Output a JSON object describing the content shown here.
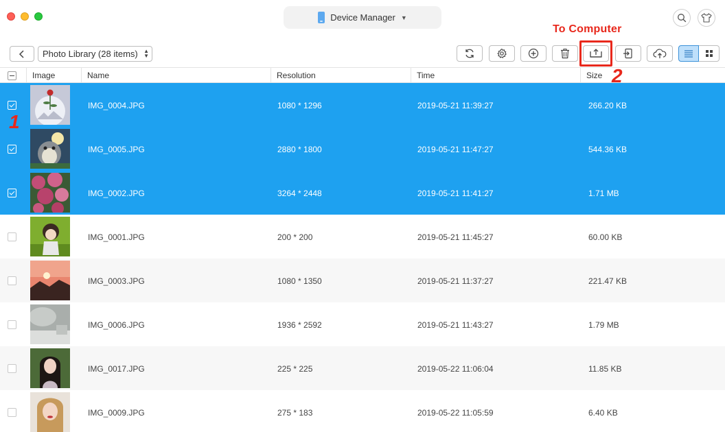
{
  "window": {
    "device_name": "Device Manager"
  },
  "annotations": {
    "to_computer_label": "To Computer",
    "step_2": "2",
    "step_1": "1"
  },
  "toolbar": {
    "library_label": "Photo Library (28 items)",
    "active_view": "list"
  },
  "table": {
    "headers": {
      "image": "Image",
      "name": "Name",
      "resolution": "Resolution",
      "time": "Time",
      "size": "Size"
    },
    "rows": [
      {
        "name": "IMG_0004.JPG",
        "resolution": "1080 * 1296",
        "time": "2019-05-21 11:39:27",
        "size": "266.20 KB",
        "selected": true,
        "thumb": "flower-on-sphere"
      },
      {
        "name": "IMG_0005.JPG",
        "resolution": "2880 * 1800",
        "time": "2019-05-21 11:47:27",
        "size": "544.36 KB",
        "selected": true,
        "thumb": "totoro"
      },
      {
        "name": "IMG_0002.JPG",
        "resolution": "3264 * 2448",
        "time": "2019-05-21 11:41:27",
        "size": "1.71 MB",
        "selected": true,
        "thumb": "pink-flowers"
      },
      {
        "name": "IMG_0001.JPG",
        "resolution": "200 * 200",
        "time": "2019-05-21 11:45:27",
        "size": "60.00 KB",
        "selected": false,
        "thumb": "doll-on-green"
      },
      {
        "name": "IMG_0003.JPG",
        "resolution": "1080 * 1350",
        "time": "2019-05-21 11:37:27",
        "size": "221.47 KB",
        "selected": false,
        "thumb": "sunset"
      },
      {
        "name": "IMG_0006.JPG",
        "resolution": "1936 * 2592",
        "time": "2019-05-21 11:43:27",
        "size": "1.79 MB",
        "selected": false,
        "thumb": "foggy-grey"
      },
      {
        "name": "IMG_0017.JPG",
        "resolution": "225 * 225",
        "time": "2019-05-22 11:06:04",
        "size": "11.85 KB",
        "selected": false,
        "thumb": "portrait-woman"
      },
      {
        "name": "IMG_0009.JPG",
        "resolution": "275 * 183",
        "time": "2019-05-22 11:05:59",
        "size": "6.40 KB",
        "selected": false,
        "thumb": "blonde-portrait"
      }
    ]
  },
  "colors": {
    "selection": "#1ea1f0",
    "annotation": "#e8281c",
    "accent": "#3a91d8"
  }
}
